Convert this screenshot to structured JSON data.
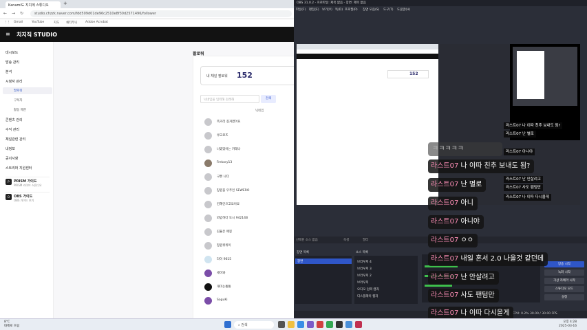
{
  "browser": {
    "tab_title": "Kanami도 지치계 스튜디오",
    "url": "studio.chzzk.naver.com/fdd509d01de96c2510e8f30d2571496/follower",
    "bookmarks": [
      "Gmail",
      "YouTube",
      "지도",
      "채티무니",
      "Adobe Acrobat"
    ]
  },
  "studio": {
    "brand": "치지직 STUDIO",
    "sidebar": [
      {
        "label": "대시보드",
        "sub": false
      },
      {
        "label": "방송 관리",
        "sub": false
      },
      {
        "label": "분석",
        "sub": false
      },
      {
        "label": "시청자 관리",
        "sub": false
      },
      {
        "label": "팔로워",
        "sub": true,
        "active": true
      },
      {
        "label": "구독자",
        "sub": true
      },
      {
        "label": "활동 제한",
        "sub": true
      },
      {
        "label": "콘텐츠 관리",
        "sub": false
      },
      {
        "label": "수익 관리",
        "sub": false
      },
      {
        "label": "채널관련 관리",
        "sub": false
      },
      {
        "label": "내정보",
        "sub": false
      },
      {
        "label": "공지사항",
        "sub": false
      },
      {
        "label": "스트리머 지원센터",
        "sub": false
      }
    ],
    "cards": [
      {
        "icon": "P",
        "title": "PRISM 가이드",
        "sub": "PRISM 라이브 스튜디오"
      },
      {
        "icon": "O",
        "title": "OBS 가이드",
        "sub": "OBS 가이드 보기"
      }
    ],
    "page_title": "팔로워",
    "follower_label": "내 채널 팔로워",
    "follower_count": "152",
    "search_placeholder": "닉네임을 입력해 검색해",
    "search_button": "검색",
    "column_nickname": "닉네임",
    "followers": [
      "족거리 길겨였어요",
      "쿠고로즈",
      "나였었어는 카레나",
      "Frekory13",
      "구쁜 나다",
      "창원을 우주인 SEWERO",
      "김혜인으고요아요",
      "와입하다 도시 94214B",
      "김율은 애봉",
      "정원위위이",
      "라이 9615",
      "세이와",
      "개미는통통",
      "SaguKi"
    ]
  },
  "obs": {
    "title": "OBS 31.0.2 - 프로파일: 제목 없음 - 장면: 제목 없음",
    "menu": [
      "파일(F)",
      "편집(E)",
      "보기(V)",
      "독(D)",
      "프로필(P)",
      "장면 모음(S)",
      "도구(T)",
      "도움말(H)"
    ],
    "source_none": "선택된 소스 없음",
    "property_btn": "속성",
    "filter_btn": "필터",
    "scene_dock": "장면 목록",
    "scene_selected": "장면",
    "source_dock": "소스 목록",
    "sources": [
      "브라우저 4",
      "브라우저 3",
      "브라우저 2",
      "브라우저",
      "오디오 입력 캡처",
      "디스플레이 캡처"
    ],
    "controls": [
      "방송 시작",
      "녹화 시작",
      "가상 카메라 시작",
      "스튜디오 모드",
      "설정"
    ],
    "status": "CPU: 0.2%   30.00 / 30.00 FPS",
    "dock_tabs": "장면 전환"
  },
  "chat": {
    "ghost": "ㅋㅋㅋㅋㅋ",
    "lines": [
      {
        "name": "라스트07",
        "msg": "나 이따 친추 보내도 됨?"
      },
      {
        "name": "라스트07",
        "msg": "난 별로"
      },
      {
        "name": "라스트07",
        "msg": "아니"
      },
      {
        "name": "라스트07",
        "msg": "아니야"
      },
      {
        "name": "라스트07",
        "msg": "ㅇㅇ"
      },
      {
        "name": "라스트07",
        "msg": "내일 혼서 2.0 나올것 같던데"
      },
      {
        "name": "라스트07",
        "msg": "난 안살려고"
      },
      {
        "name": "라스트07",
        "msg": "사도 팬텀만"
      },
      {
        "name": "라스트07",
        "msg": "나 이따 다시올게"
      }
    ],
    "mini": [
      "라스트07 나 이따 친추 보내도 됨?",
      "라스트07 난 별로",
      "라스트07 아니야",
      "라스트07 내일 혼서",
      "라스트07 난 안살려고",
      "라스트07 사도 팬텀만",
      "라스트07 나 이따 다시올게"
    ]
  },
  "taskbar": {
    "weather_temp": "8°C",
    "weather_text": "대체로 흐림",
    "search": "검색",
    "time": "오후 4:28",
    "date": "2025-03-16"
  },
  "colors": {
    "chat_name": "#ff8fb8",
    "obs_bg": "#2b2e38",
    "studio_dark": "#121212",
    "accent_blue": "#2f56c8"
  }
}
